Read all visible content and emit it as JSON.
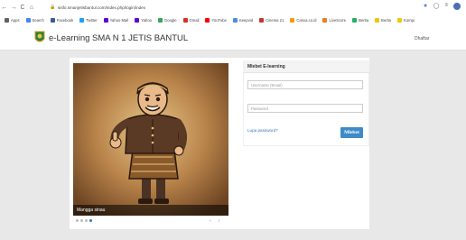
{
  "browser": {
    "back": "←",
    "forward": "→",
    "reload": "C",
    "home": "⌂",
    "url": "sisfo.smanjetisbantul.com/index.php/login/index",
    "bookmarks": [
      {
        "label": "Apps",
        "color": "#5f6368"
      },
      {
        "label": "Search",
        "color": "#4285f4"
      },
      {
        "label": "Facebook",
        "color": "#3b5998"
      },
      {
        "label": "Twitter",
        "color": "#1da1f2"
      },
      {
        "label": "Yahoo Mail",
        "color": "#6001d2"
      },
      {
        "label": "Yahoo",
        "color": "#6001d2"
      },
      {
        "label": "Google",
        "color": "#34a853"
      },
      {
        "label": "Gmail",
        "color": "#d93025"
      },
      {
        "label": "YouTube",
        "color": "#ff0000"
      },
      {
        "label": "Keepvid",
        "color": "#4a90d9"
      },
      {
        "label": "Cinema 21",
        "color": "#c0392b"
      },
      {
        "label": "Canva.co.id",
        "color": "#f39c12"
      },
      {
        "label": "LiveScore",
        "color": "#e67e22"
      },
      {
        "label": "Berita",
        "color": "#27ae60"
      },
      {
        "label": "Berita",
        "color": "#f1c40f"
      },
      {
        "label": "Kompi",
        "color": "#f1c40f"
      }
    ]
  },
  "site": {
    "title": "e-Learning SMA N 1 JETIS BANTUL",
    "register": "Dhaftar"
  },
  "slider": {
    "caption": "Mangga sinau",
    "prev": "‹",
    "next": "›"
  },
  "login": {
    "heading": "Mlebet E-learning",
    "username_placeholder": "Username (Email)",
    "password_placeholder": "Password",
    "forgot": "Lupa password?",
    "button": "Mlebet"
  },
  "colors": {
    "accent": "#3d8bc9",
    "page_bg": "#e8e8e8"
  }
}
